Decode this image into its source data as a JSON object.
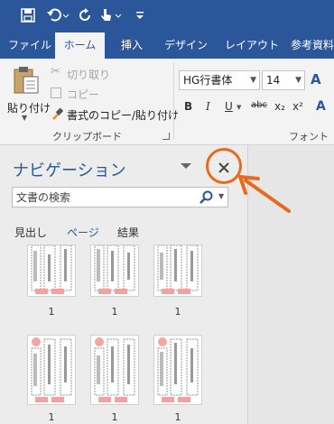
{
  "quick_access": {
    "icons": [
      "save-icon",
      "undo-icon",
      "redo-icon",
      "touch-mode-icon",
      "customize-icon"
    ]
  },
  "tabs": [
    {
      "label": "ファイル",
      "active": false
    },
    {
      "label": "ホーム",
      "active": true
    },
    {
      "label": "挿入",
      "active": false
    },
    {
      "label": "デザイン",
      "active": false
    },
    {
      "label": "レイアウト",
      "active": false
    },
    {
      "label": "参考資料",
      "active": false
    }
  ],
  "clipboard": {
    "paste_label": "貼り付け",
    "cut_label": "切り取り",
    "copy_label": "コピー",
    "format_painter_label": "書式のコピー/貼り付け",
    "group_label": "クリップボード"
  },
  "font": {
    "family": "HG行書体",
    "size": "14",
    "group_label": "フォント",
    "format_buttons": [
      "B",
      "I",
      "U",
      "abc",
      "x₂",
      "x²"
    ]
  },
  "navigation": {
    "title": "ナビゲーション",
    "search_placeholder": "文書の検索",
    "tabs": [
      "見出し",
      "ページ",
      "結果"
    ],
    "active_tab": "ページ",
    "page_labels": [
      "1",
      "1",
      "1",
      "1",
      "1",
      "1"
    ]
  },
  "colors": {
    "accent": "#2b579a",
    "annotation": "#e86a1f"
  }
}
